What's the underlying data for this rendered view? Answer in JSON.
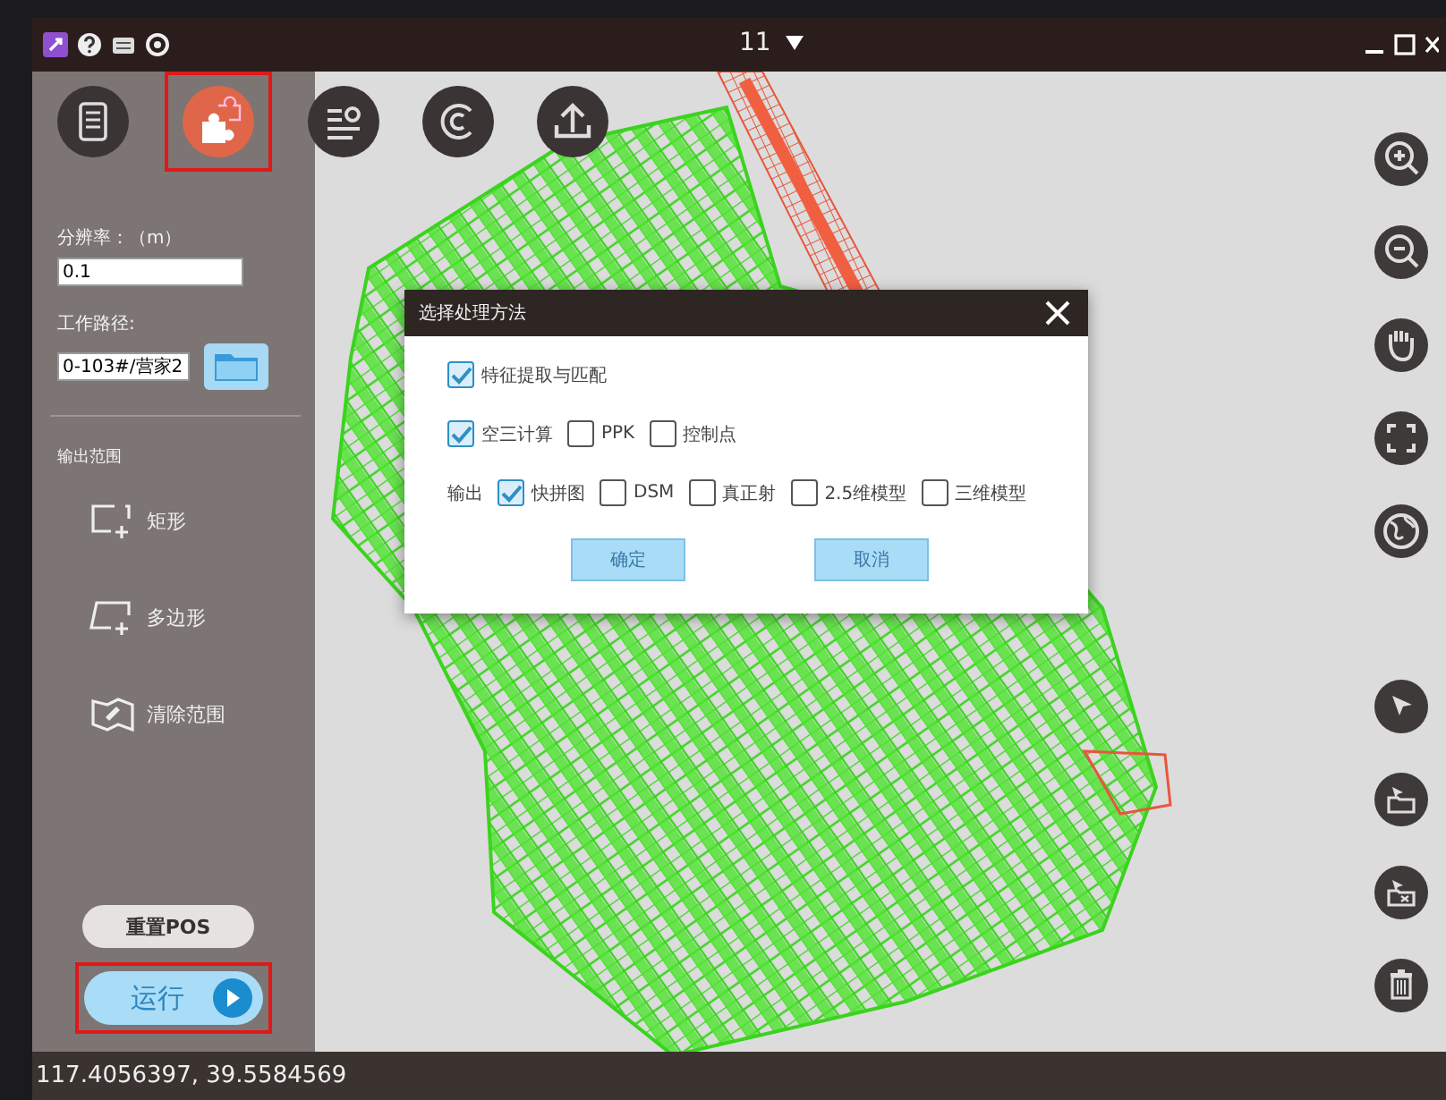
{
  "window": {
    "title": "11"
  },
  "tools": [
    {
      "selected": false
    },
    {
      "selected": true
    },
    {
      "selected": false
    },
    {
      "selected": false
    },
    {
      "selected": false
    }
  ],
  "sidebar": {
    "resolution_label": "分辨率：（m）",
    "resolution_value": "0.1",
    "path_label": "工作路径:",
    "path_value": "0-103#/营家2",
    "output_range_label": "输出范围",
    "range_tools": [
      {
        "label": "矩形",
        "kind": "rect"
      },
      {
        "label": "多边形",
        "kind": "polygon"
      },
      {
        "label": "清除范围",
        "kind": "clear"
      }
    ],
    "reset_button": "重置POS",
    "run_button": {
      "label": "运行",
      "highlighted": true
    }
  },
  "dialog": {
    "title": "选择处理方法",
    "rows": [
      {
        "options": [
          {
            "label": "特征提取与匹配",
            "checked": true
          }
        ]
      },
      {
        "options": [
          {
            "label": "空三计算",
            "checked": true
          },
          {
            "label": "PPK",
            "checked": false
          },
          {
            "label": "控制点",
            "checked": false
          }
        ]
      },
      {
        "label": "输出",
        "options": [
          {
            "label": "快拼图",
            "checked": true
          },
          {
            "label": "DSM",
            "checked": false
          },
          {
            "label": "真正射",
            "checked": false
          },
          {
            "label": "2.5维模型",
            "checked": false
          },
          {
            "label": "三维模型",
            "checked": false
          }
        ]
      }
    ],
    "buttons": [
      "确定",
      "取消"
    ]
  },
  "status_bar": {
    "coordinates": "117.4056397, 39.5584569"
  }
}
